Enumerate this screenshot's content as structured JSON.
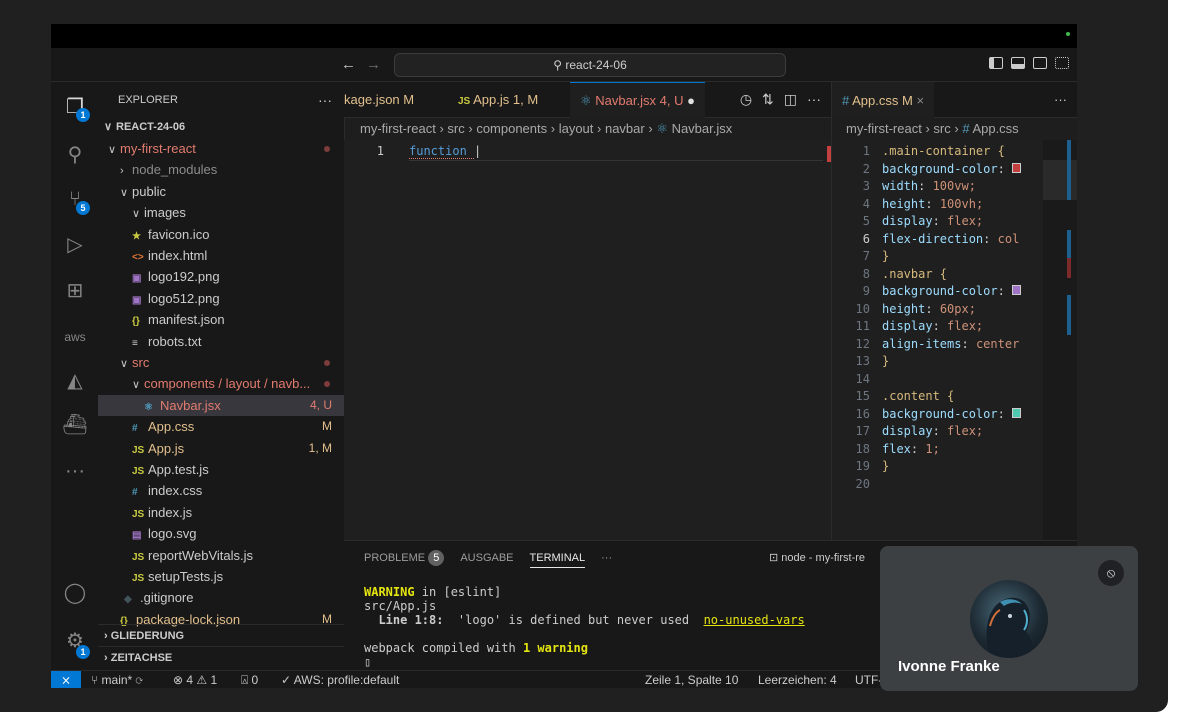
{
  "titlebar": {
    "search": "react-24-06",
    "nav_back": "←",
    "nav_forward": "→"
  },
  "activity": {
    "explorer_badge": "1",
    "scm_badge": "5",
    "aws_label": "aws",
    "accounts_badge": "1"
  },
  "explorer": {
    "title": "EXPLORER",
    "more": "···",
    "workspace": "REACT-24-06",
    "tree": [
      {
        "label": "my-first-react",
        "type": "folder-open",
        "color": "#e27b6f",
        "dot": true
      },
      {
        "label": "node_modules",
        "type": "folder-closed",
        "color": "#8c8c8c"
      },
      {
        "label": "public",
        "type": "folder-open",
        "color": "#cccccc"
      },
      {
        "label": "images",
        "type": "folder-open",
        "color": "#cccccc"
      },
      {
        "label": "favicon.ico",
        "type": "file",
        "icon": "★",
        "iconColor": "#cbcb41",
        "color": "#cccccc"
      },
      {
        "label": "index.html",
        "type": "file",
        "icon": "<>",
        "iconColor": "#e37933",
        "color": "#cccccc"
      },
      {
        "label": "logo192.png",
        "type": "file",
        "icon": "▣",
        "iconColor": "#a074c4",
        "color": "#cccccc"
      },
      {
        "label": "logo512.png",
        "type": "file",
        "icon": "▣",
        "iconColor": "#a074c4",
        "color": "#cccccc"
      },
      {
        "label": "manifest.json",
        "type": "file",
        "icon": "{}",
        "iconColor": "#cbcb41",
        "color": "#cccccc"
      },
      {
        "label": "robots.txt",
        "type": "file",
        "icon": "≡",
        "iconColor": "#cccccc",
        "color": "#cccccc"
      },
      {
        "label": "src",
        "type": "folder-open",
        "color": "#e27b6f",
        "dot": true
      },
      {
        "label": "components",
        "label2": "layout",
        "label3": "navb...",
        "type": "folder-open",
        "color": "#e27b6f",
        "dot": true
      },
      {
        "label": "Navbar.jsx",
        "type": "file",
        "icon": "⚛",
        "iconColor": "#519aba",
        "color": "#e27b6f",
        "dec": "4, U",
        "selected": true
      },
      {
        "label": "App.css",
        "type": "file",
        "icon": "#",
        "iconColor": "#519aba",
        "color": "#e2c08d",
        "dec": "M"
      },
      {
        "label": "App.js",
        "type": "file",
        "icon": "JS",
        "iconColor": "#cbcb41",
        "color": "#e2c08d",
        "dec": "1, M"
      },
      {
        "label": "App.test.js",
        "type": "file",
        "icon": "JS",
        "iconColor": "#cbcb41",
        "color": "#cccccc"
      },
      {
        "label": "index.css",
        "type": "file",
        "icon": "#",
        "iconColor": "#519aba",
        "color": "#cccccc"
      },
      {
        "label": "index.js",
        "type": "file",
        "icon": "JS",
        "iconColor": "#cbcb41",
        "color": "#cccccc"
      },
      {
        "label": "logo.svg",
        "type": "file",
        "icon": "▤",
        "iconColor": "#a074c4",
        "color": "#cccccc"
      },
      {
        "label": "reportWebVitals.js",
        "type": "file",
        "icon": "JS",
        "iconColor": "#cbcb41",
        "color": "#cccccc"
      },
      {
        "label": "setupTests.js",
        "type": "file",
        "icon": "JS",
        "iconColor": "#cbcb41",
        "color": "#cccccc"
      },
      {
        "label": ".gitignore",
        "type": "file",
        "icon": "◆",
        "iconColor": "#41535b",
        "color": "#cccccc"
      },
      {
        "label": "package-lock.json",
        "type": "file",
        "icon": "{}",
        "iconColor": "#cbcb41",
        "color": "#e2c08d",
        "dec": "M"
      }
    ],
    "outline": "GLIEDERUNG",
    "timeline": "ZEITACHSE"
  },
  "tabs_left": [
    {
      "label": "kage.json",
      "status": "M",
      "icon": "",
      "statusColor": "#e2c08d"
    },
    {
      "label": "App.js",
      "status": "1, M",
      "icon": "JS",
      "statusColor": "#e2c08d"
    },
    {
      "label": "Navbar.jsx",
      "status": "4, U",
      "icon": "⚛",
      "statusColor": "#e27b6f",
      "active": true
    }
  ],
  "tabs_right": [
    {
      "label": "App.css",
      "status": "M",
      "icon": "#"
    }
  ],
  "breadcrumb_left": [
    "my-first-react",
    "src",
    "components",
    "layout",
    "navbar",
    "Navbar.jsx"
  ],
  "breadcrumb_right": [
    "my-first-react",
    "src",
    "App.css"
  ],
  "editor_left": {
    "line_number": "1",
    "code": "function "
  },
  "editor_right": {
    "lines": [
      {
        "n": "1",
        "t": ".main-container {"
      },
      {
        "n": "2",
        "t": "  background-color: "
      },
      {
        "n": "3",
        "t": "  width: 100vw;"
      },
      {
        "n": "4",
        "t": "  height: 100vh;"
      },
      {
        "n": "5",
        "t": "  display: flex;"
      },
      {
        "n": "6",
        "t": "  flex-direction: col"
      },
      {
        "n": "7",
        "t": "}"
      },
      {
        "n": "8",
        "t": ".navbar {"
      },
      {
        "n": "9",
        "t": "  background-color: "
      },
      {
        "n": "10",
        "t": "  height: 60px;"
      },
      {
        "n": "11",
        "t": "  display: flex;"
      },
      {
        "n": "12",
        "t": "  align-items: center"
      },
      {
        "n": "13",
        "t": "}"
      },
      {
        "n": "14",
        "t": ""
      },
      {
        "n": "15",
        "t": ".content {"
      },
      {
        "n": "16",
        "t": "  background-color: "
      },
      {
        "n": "17",
        "t": "  display: flex;"
      },
      {
        "n": "18",
        "t": "  flex: 1;"
      },
      {
        "n": "19",
        "t": "}"
      },
      {
        "n": "20",
        "t": ""
      }
    ]
  },
  "panel": {
    "problems": "PROBLEME",
    "problems_count": "5",
    "output": "AUSGABE",
    "terminal": "TERMINAL",
    "more": "···",
    "terminal_name": "node - my-first-re",
    "lines": {
      "warn_kw": "WARNING",
      "warn_rest": " in [eslint]",
      "file": "src/App.js",
      "line_pos": "  Line 1:8:",
      "msg": "  'logo' is defined but never used  ",
      "rule": "no-unused-vars",
      "compiled": "webpack compiled with ",
      "compiled_bold": "1 warning"
    }
  },
  "statusbar": {
    "branch": "main*",
    "errors": "⊗ 4",
    "warnings": "⚠ 1",
    "ports": "0",
    "aws": "AWS: profile:default",
    "position": "Zeile 1, Spalte 10",
    "spaces": "Leerzeichen: 4",
    "encoding": "UTF-"
  },
  "video": {
    "name": "Ivonne Franke"
  }
}
